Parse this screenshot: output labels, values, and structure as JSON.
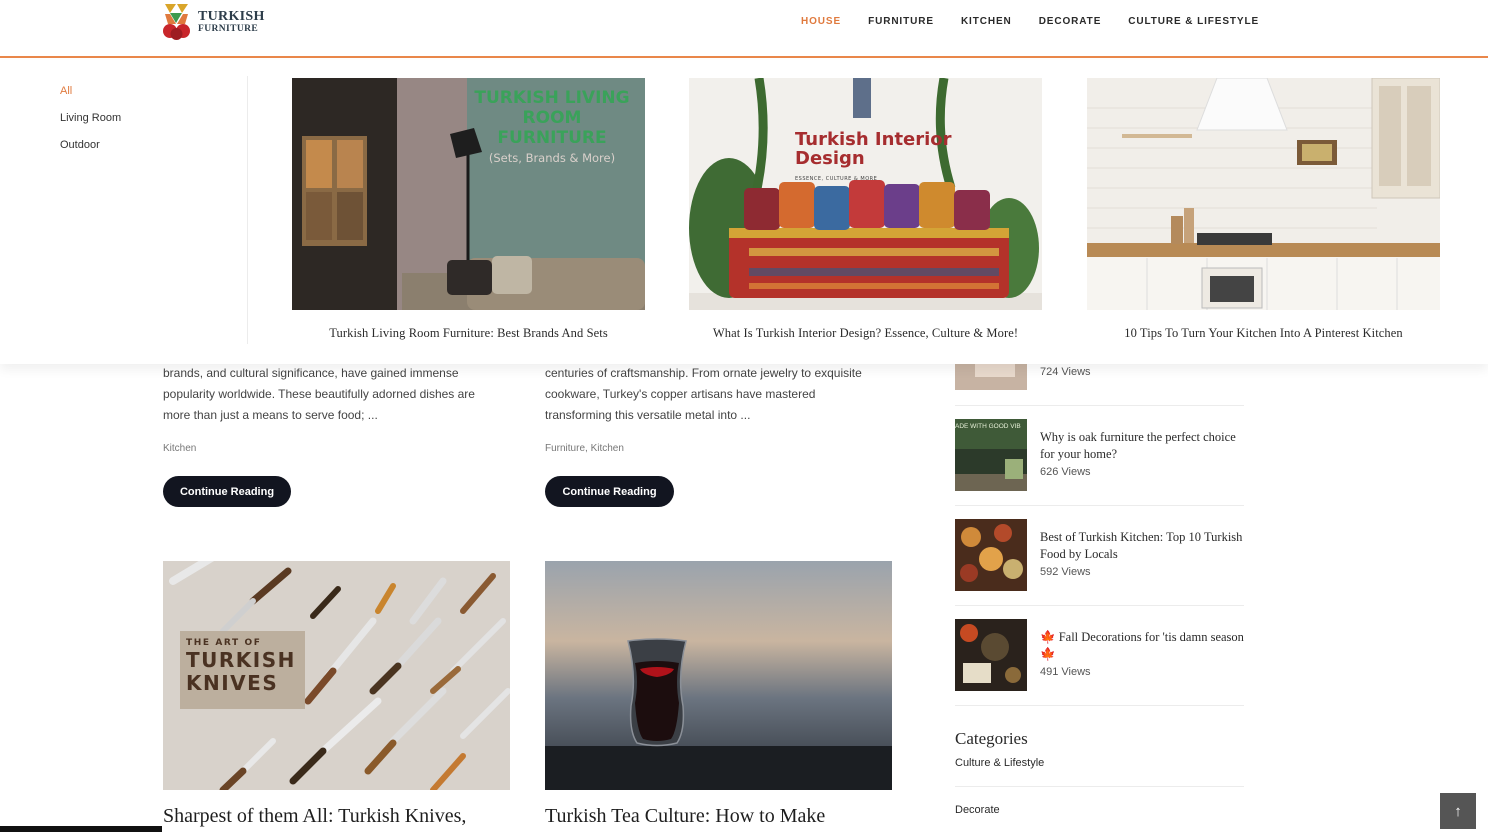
{
  "header": {
    "logo_line1": "TURKISH",
    "logo_line2": "FURNITURE",
    "nav": [
      "HOUSE",
      "FURNITURE",
      "KITCHEN",
      "DECORATE",
      "CULTURE & LIFESTYLE"
    ],
    "active_nav": "HOUSE",
    "accent_color": "#e07a3e"
  },
  "mega_menu": {
    "subcategories": [
      "All",
      "Living Room",
      "Outdoor"
    ],
    "active_subcategory": "All",
    "cards": [
      {
        "title": "Turkish Living Room Furniture: Best Brands And Sets",
        "image_heading_1": "TURKISH LIVING",
        "image_heading_2": "ROOM FURNITURE",
        "image_subheading": "(Sets, Brands & More)"
      },
      {
        "title": "What Is Turkish Interior Design? Essence, Culture & More!",
        "image_heading_1": "Turkish Interior",
        "image_heading_2": "Design",
        "image_subheading": "ESSENCE, CULTURE & MORE"
      },
      {
        "title": "10 Tips To Turn Your Kitchen Into A Pinterest Kitchen"
      }
    ]
  },
  "posts": [
    {
      "excerpt": [
        "brands, and cultural significance, have gained immense",
        "popularity worldwide. These beautifully adorned dishes are",
        "more than just a means to serve food; ..."
      ],
      "category": "Kitchen",
      "button": "Continue Reading"
    },
    {
      "excerpt": [
        "centuries of craftsmanship. From ornate jewelry to exquisite",
        "cookware, Turkey's copper artisans have mastered",
        "transforming this versatile metal into ..."
      ],
      "category": "Furniture, Kitchen",
      "button": "Continue Reading"
    },
    {
      "title": "Sharpest of them All: Turkish Knives,",
      "image_label_small": "THE ART OF",
      "image_label_1": "TURKISH",
      "image_label_2": "KNIVES"
    },
    {
      "title": "Turkish Tea Culture: How to Make"
    }
  ],
  "sidebar": {
    "popular": [
      {
        "title": "",
        "views": "724 Views"
      },
      {
        "title": "Why is oak furniture the perfect choice for your home?",
        "views": "626 Views",
        "thumb_text": "ADE WITH GOOD VIB"
      },
      {
        "title": "Best of Turkish Kitchen: Top 10 Turkish Food by Locals",
        "views": "592 Views"
      },
      {
        "title": "Fall Decorations for 'tis damn season",
        "views": "491 Views",
        "leaf_emoji": "🍁"
      }
    ],
    "categories_heading": "Categories",
    "categories": [
      "Culture & Lifestyle",
      "Decorate"
    ]
  },
  "back_to_top": "↑"
}
